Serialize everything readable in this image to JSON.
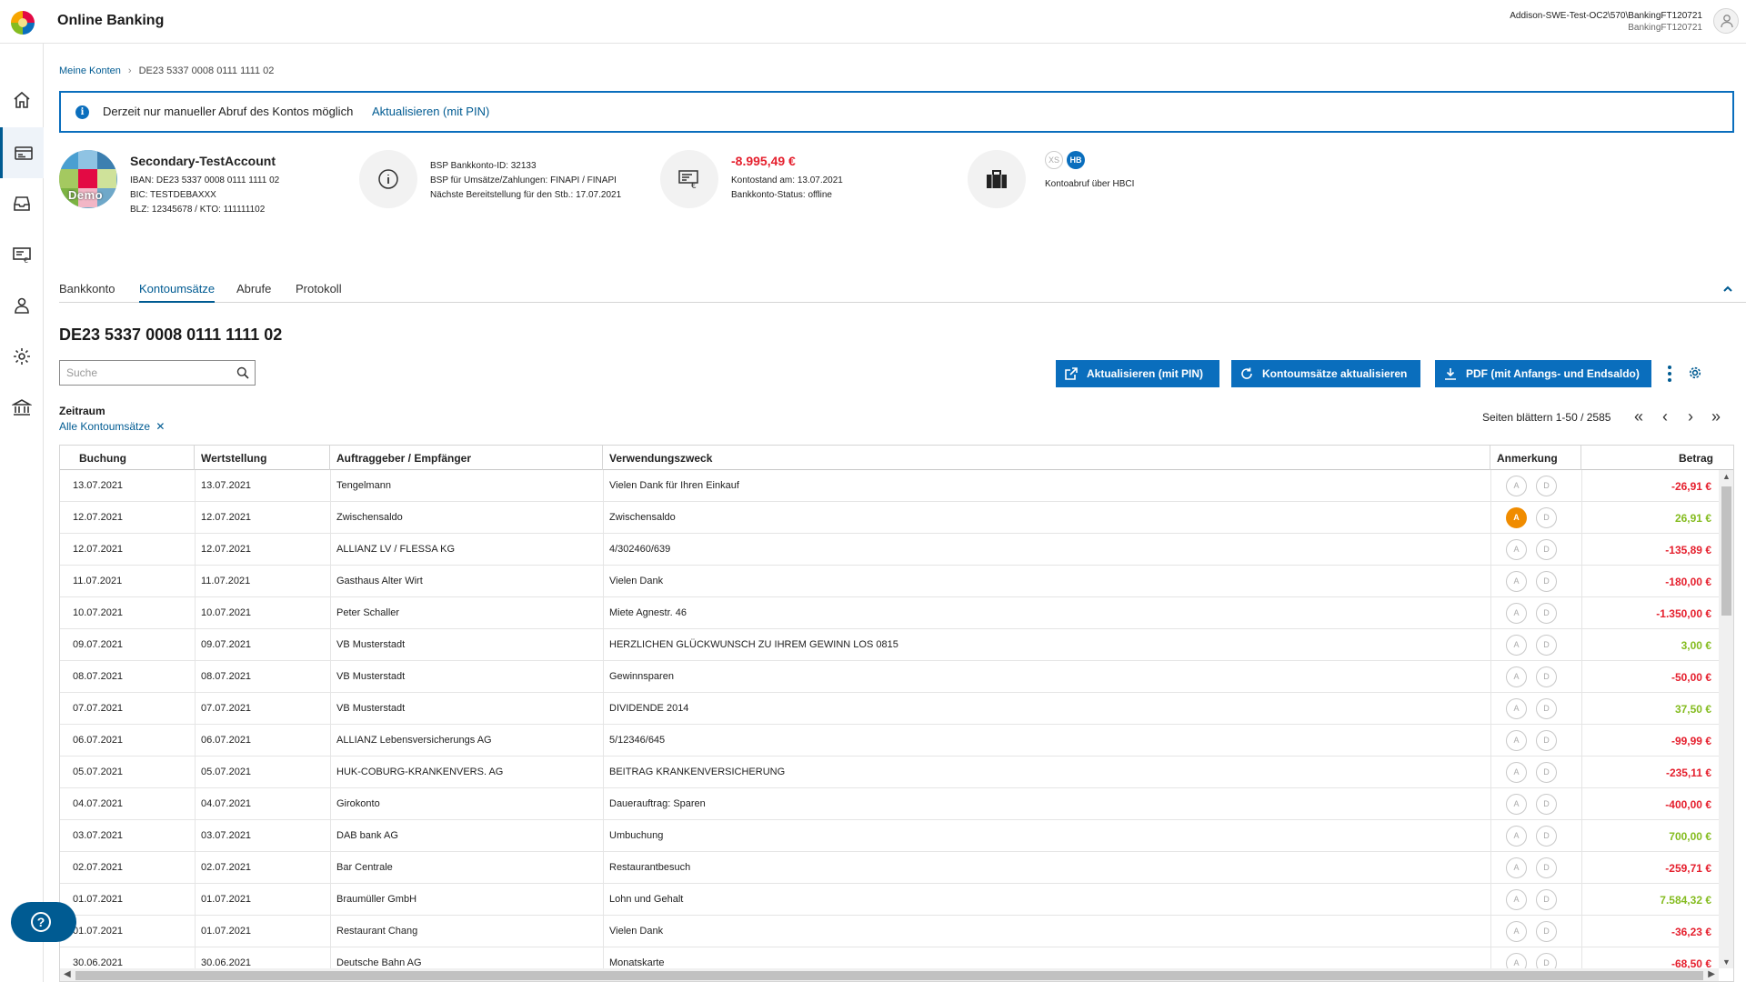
{
  "app": {
    "title": "Online Banking",
    "user_line1": "Addison-SWE-Test-OC2\\570\\BankingFT120721",
    "user_line2": "BankingFT120721"
  },
  "breadcrumb": {
    "root": "Meine Konten",
    "current": "DE23 5337 0008 0111 1111 02"
  },
  "infobar": {
    "message": "Derzeit nur manueller Abruf des Kontos möglich",
    "link": "Aktualisieren (mit PIN)"
  },
  "account": {
    "avatar_label": "Demo",
    "name": "Secondary-TestAccount",
    "iban": "IBAN: DE23 5337 0008 0111 1111 02",
    "bic": "BIC: TESTDEBAXXX",
    "blz": "BLZ: 12345678 / KTO: 111111102",
    "bsp_id": "BSP Bankkonto-ID: 32133",
    "bsp_umsaetze": "BSP für Umsätze/Zahlungen: FINAPI / FINAPI",
    "bsp_next": "Nächste Bereitstellung für den Stb.: 17.07.2021",
    "balance": "-8.995,49 €",
    "balance_date": "Kontostand am: 13.07.2021",
    "status": "Bankkonto-Status: offline",
    "badge_xs": "XS",
    "badge_hb": "HB",
    "abruf": "Kontoabruf über HBCI"
  },
  "colors": {
    "primary": "#0a6ebd",
    "link": "#005b92",
    "negative": "#e5202e",
    "positive": "#85bc20",
    "annotation_active": "#f08c00"
  },
  "tabs": [
    {
      "label": "Bankkonto"
    },
    {
      "label": "Kontoumsätze"
    },
    {
      "label": "Abrufe"
    },
    {
      "label": "Protokoll"
    }
  ],
  "section_title": "DE23 5337 0008 0111 1111 02",
  "search": {
    "placeholder": "Suche"
  },
  "buttons": {
    "update_pin": "Aktualisieren (mit PIN)",
    "update_tx": "Kontoumsätze aktualisieren",
    "pdf": "PDF (mit Anfangs- und Endsaldo)"
  },
  "filter": {
    "label": "Zeitraum",
    "value": "Alle Kontoumsätze"
  },
  "pager": {
    "text": "Seiten blättern 1-50 / 2585"
  },
  "table": {
    "headers": [
      "Buchung",
      "Wertstellung",
      "Auftraggeber / Empfänger",
      "Verwendungszweck",
      "Anmerkung",
      "Betrag"
    ],
    "annotation_labels": [
      "A",
      "D"
    ],
    "rows": [
      {
        "buchung": "13.07.2021",
        "wert": "13.07.2021",
        "partner": "Tengelmann",
        "zweck": "Vielen Dank für Ihren Einkauf",
        "betrag": "-26,91 €",
        "positive": false,
        "a_active": false
      },
      {
        "buchung": "12.07.2021",
        "wert": "12.07.2021",
        "partner": "Zwischensaldo",
        "zweck": "Zwischensaldo",
        "betrag": "26,91 €",
        "positive": true,
        "a_active": true
      },
      {
        "buchung": "12.07.2021",
        "wert": "12.07.2021",
        "partner": "ALLIANZ LV / FLESSA KG",
        "zweck": "4/302460/639",
        "betrag": "-135,89 €",
        "positive": false,
        "a_active": false
      },
      {
        "buchung": "11.07.2021",
        "wert": "11.07.2021",
        "partner": "Gasthaus Alter Wirt",
        "zweck": "Vielen Dank",
        "betrag": "-180,00 €",
        "positive": false,
        "a_active": false
      },
      {
        "buchung": "10.07.2021",
        "wert": "10.07.2021",
        "partner": "Peter Schaller",
        "zweck": "Miete Agnestr. 46",
        "betrag": "-1.350,00 €",
        "positive": false,
        "a_active": false
      },
      {
        "buchung": "09.07.2021",
        "wert": "09.07.2021",
        "partner": "VB Musterstadt",
        "zweck": "HERZLICHEN GLÜCKWUNSCH ZU IHREM GEWINN LOS 0815",
        "betrag": "3,00 €",
        "positive": true,
        "a_active": false
      },
      {
        "buchung": "08.07.2021",
        "wert": "08.07.2021",
        "partner": "VB Musterstadt",
        "zweck": "Gewinnsparen",
        "betrag": "-50,00 €",
        "positive": false,
        "a_active": false
      },
      {
        "buchung": "07.07.2021",
        "wert": "07.07.2021",
        "partner": "VB Musterstadt",
        "zweck": "DIVIDENDE 2014",
        "betrag": "37,50 €",
        "positive": true,
        "a_active": false
      },
      {
        "buchung": "06.07.2021",
        "wert": "06.07.2021",
        "partner": "ALLIANZ Lebensversicherungs AG",
        "zweck": "5/12346/645",
        "betrag": "-99,99 €",
        "positive": false,
        "a_active": false
      },
      {
        "buchung": "05.07.2021",
        "wert": "05.07.2021",
        "partner": "HUK-COBURG-KRANKENVERS. AG",
        "zweck": "BEITRAG KRANKENVERSICHERUNG",
        "betrag": "-235,11 €",
        "positive": false,
        "a_active": false
      },
      {
        "buchung": "04.07.2021",
        "wert": "04.07.2021",
        "partner": "Girokonto",
        "zweck": "Dauerauftrag: Sparen",
        "betrag": "-400,00 €",
        "positive": false,
        "a_active": false
      },
      {
        "buchung": "03.07.2021",
        "wert": "03.07.2021",
        "partner": "DAB bank AG",
        "zweck": "Umbuchung",
        "betrag": "700,00 €",
        "positive": true,
        "a_active": false
      },
      {
        "buchung": "02.07.2021",
        "wert": "02.07.2021",
        "partner": "Bar Centrale",
        "zweck": "Restaurantbesuch",
        "betrag": "-259,71 €",
        "positive": false,
        "a_active": false
      },
      {
        "buchung": "01.07.2021",
        "wert": "01.07.2021",
        "partner": "Braumüller GmbH",
        "zweck": "Lohn und Gehalt",
        "betrag": "7.584,32 €",
        "positive": true,
        "a_active": false
      },
      {
        "buchung": "01.07.2021",
        "wert": "01.07.2021",
        "partner": "Restaurant Chang",
        "zweck": "Vielen Dank",
        "betrag": "-36,23 €",
        "positive": false,
        "a_active": false
      },
      {
        "buchung": "30.06.2021",
        "wert": "30.06.2021",
        "partner": "Deutsche Bahn AG",
        "zweck": "Monatskarte",
        "betrag": "-68,50 €",
        "positive": false,
        "a_active": false
      }
    ]
  }
}
